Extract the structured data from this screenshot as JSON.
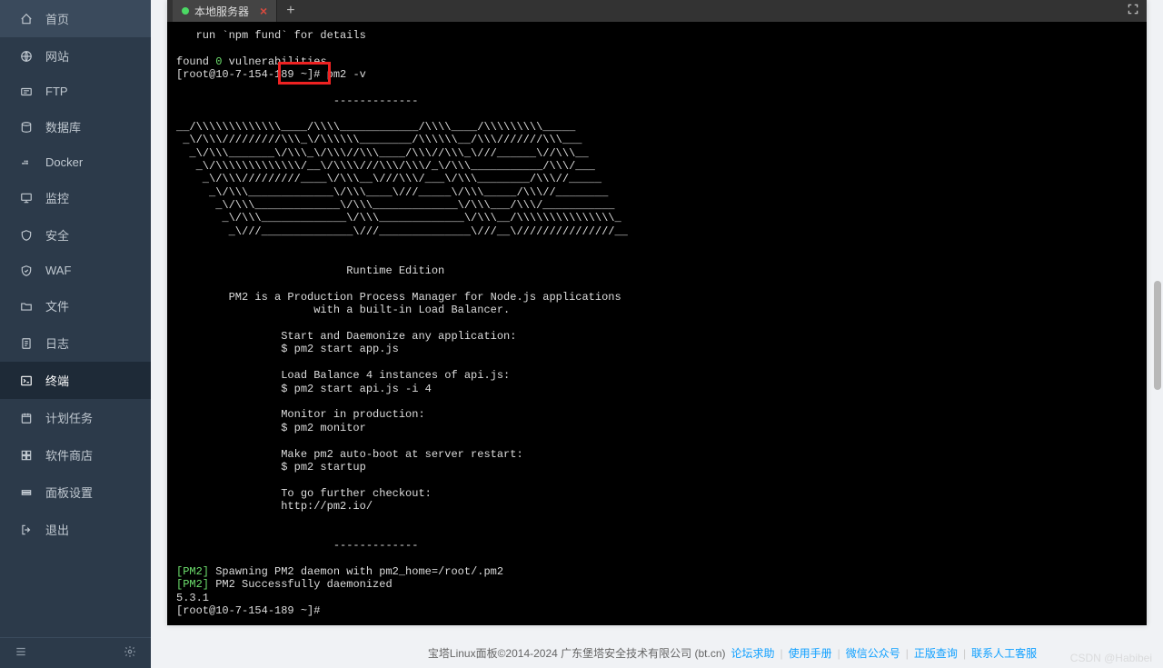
{
  "sidebar": {
    "items": [
      {
        "label": "首页",
        "icon": "home"
      },
      {
        "label": "网站",
        "icon": "globe"
      },
      {
        "label": "FTP",
        "icon": "ftp"
      },
      {
        "label": "数据库",
        "icon": "database"
      },
      {
        "label": "Docker",
        "icon": "docker"
      },
      {
        "label": "监控",
        "icon": "monitor"
      },
      {
        "label": "安全",
        "icon": "shield"
      },
      {
        "label": "WAF",
        "icon": "waf"
      },
      {
        "label": "文件",
        "icon": "folder"
      },
      {
        "label": "日志",
        "icon": "log"
      },
      {
        "label": "终端",
        "icon": "terminal",
        "active": true
      },
      {
        "label": "计划任务",
        "icon": "schedule"
      },
      {
        "label": "软件商店",
        "icon": "store"
      },
      {
        "label": "面板设置",
        "icon": "settings"
      },
      {
        "label": "退出",
        "icon": "logout"
      }
    ]
  },
  "tabbar": {
    "active_tab": "本地服务器",
    "add_symbol": "+"
  },
  "terminal": {
    "intro_line": "   run `npm fund` for details",
    "vuln_prefix": "found ",
    "vuln_count": "0",
    "vuln_suffix": " vulnerabilities",
    "prompt1": "[root@10-7-154-189 ~]# ",
    "command1": "pm2 -v",
    "ascii": "\n                        -------------\n\n__/\\\\\\\\\\\\\\\\\\\\\\\\\\____/\\\\\\\\____________/\\\\\\\\____/\\\\\\\\\\\\\\\\\\_____\n _\\/\\\\\\/////////\\\\\\_\\/\\\\\\\\\\\\________/\\\\\\\\\\\\__/\\\\\\///////\\\\\\___\n  _\\/\\\\\\_______\\/\\\\\\_\\/\\\\\\//\\\\\\____/\\\\\\//\\\\\\_\\///______\\//\\\\\\__\n   _\\/\\\\\\\\\\\\\\\\\\\\\\\\\\/__\\/\\\\\\\\///\\\\\\/\\\\\\/_\\/\\\\\\___________/\\\\\\/___\n    _\\/\\\\\\/////////____\\/\\\\\\__\\///\\\\\\/___\\/\\\\\\________/\\\\\\//_____\n     _\\/\\\\\\_____________\\/\\\\\\____\\///_____\\/\\\\\\_____/\\\\\\//________\n      _\\/\\\\\\_____________\\/\\\\\\_____________\\/\\\\\\___/\\\\\\/___________\n       _\\/\\\\\\_____________\\/\\\\\\_____________\\/\\\\\\__/\\\\\\\\\\\\\\\\\\\\\\\\\\\\\\_\n        _\\///______________\\///______________\\///__\\///////////////__\n",
    "runtime_edition": "                          Runtime Edition",
    "desc1": "        PM2 is a Production Process Manager for Node.js applications",
    "desc2": "                     with a built-in Load Balancer.",
    "start1": "                Start and Daemonize any application:",
    "start2": "                $ pm2 start app.js",
    "lb1": "                Load Balance 4 instances of api.js:",
    "lb2": "                $ pm2 start api.js -i 4",
    "mon1": "                Monitor in production:",
    "mon2": "                $ pm2 monitor",
    "boot1": "                Make pm2 auto-boot at server restart:",
    "boot2": "                $ pm2 startup",
    "further1": "                To go further checkout:",
    "further2": "                http://pm2.io/",
    "sep2": "                        -------------",
    "pm2_tag1": "[PM2]",
    "spawn_msg": " Spawning PM2 daemon with pm2_home=/root/.pm2",
    "pm2_tag2": "[PM2]",
    "daemonized_msg": " PM2 Successfully daemonized",
    "version": "5.3.1",
    "prompt2": "[root@10-7-154-189 ~]# "
  },
  "footer": {
    "copyright": "宝塔Linux面板©2014-2024 广东堡塔安全技术有限公司 (bt.cn)",
    "links": [
      "论坛求助",
      "使用手册",
      "微信公众号",
      "正版查询",
      "联系人工客服"
    ]
  },
  "watermark": "CSDN @Habibei"
}
